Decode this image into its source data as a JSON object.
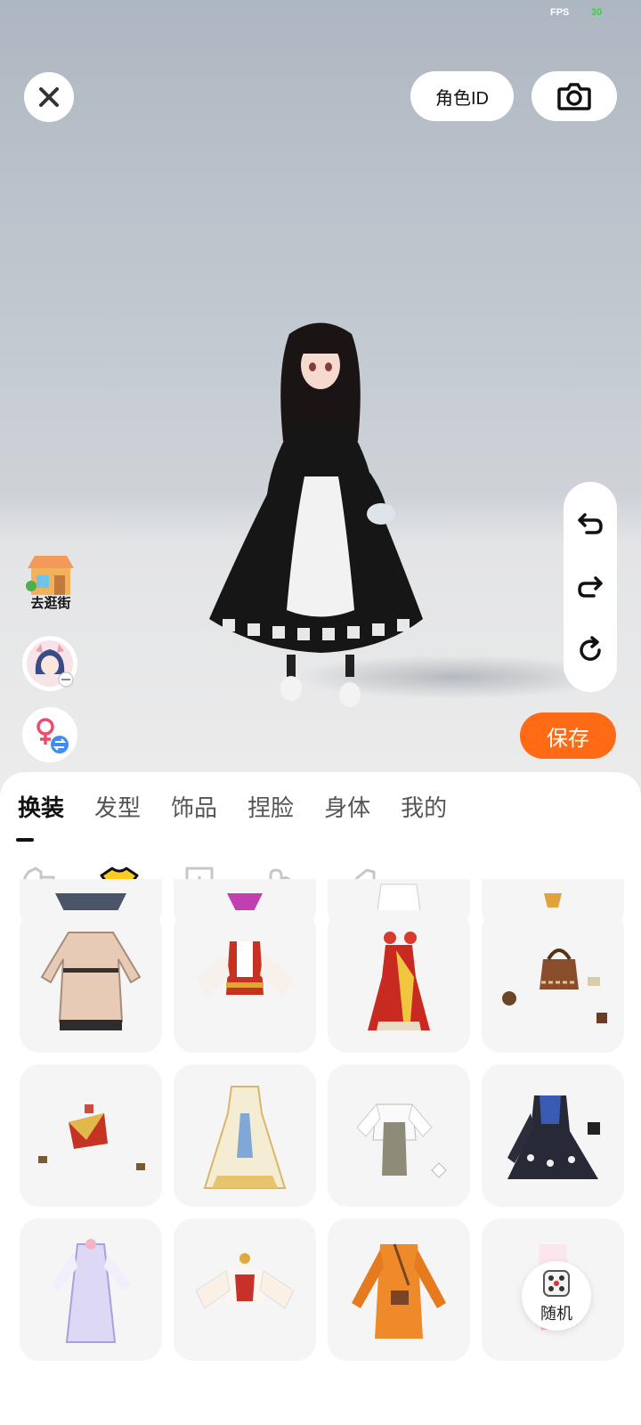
{
  "status": {
    "fps_label": "FPS",
    "fps_value": "30"
  },
  "header": {
    "role_id_label": "角色ID",
    "close_icon": "close-icon",
    "camera_icon": "camera-icon"
  },
  "side_actions": {
    "shop_label": "去逛街",
    "avatar_icon": "avatar-icon",
    "gender_icon": "gender-switch-icon"
  },
  "history": {
    "undo_icon": "undo-icon",
    "redo_icon": "redo-icon",
    "reset_icon": "reset-icon"
  },
  "save_label": "保存",
  "tabs": [
    {
      "label": "换装",
      "active": true
    },
    {
      "label": "发型",
      "active": false
    },
    {
      "label": "饰品",
      "active": false
    },
    {
      "label": "捏脸",
      "active": false
    },
    {
      "label": "身体",
      "active": false
    },
    {
      "label": "我的",
      "active": false
    }
  ],
  "subcategories": [
    "all-outfit-icon",
    "top-icon",
    "bottom-icon",
    "gloves-icon",
    "shoes-icon"
  ],
  "outfits": [
    "beige-trench-dress",
    "red-white-blouse",
    "red-gold-dress",
    "brown-bag-set",
    "red-cap-set",
    "white-gold-gown",
    "grey-vest-blouse",
    "black-blue-dress",
    "lavender-gown",
    "white-red-top",
    "orange-jacket",
    "pink-white-item"
  ],
  "random_label": "随机",
  "colors": {
    "accent": "#ff6a14",
    "panel": "#ffffff",
    "card": "#f5f5f5"
  }
}
